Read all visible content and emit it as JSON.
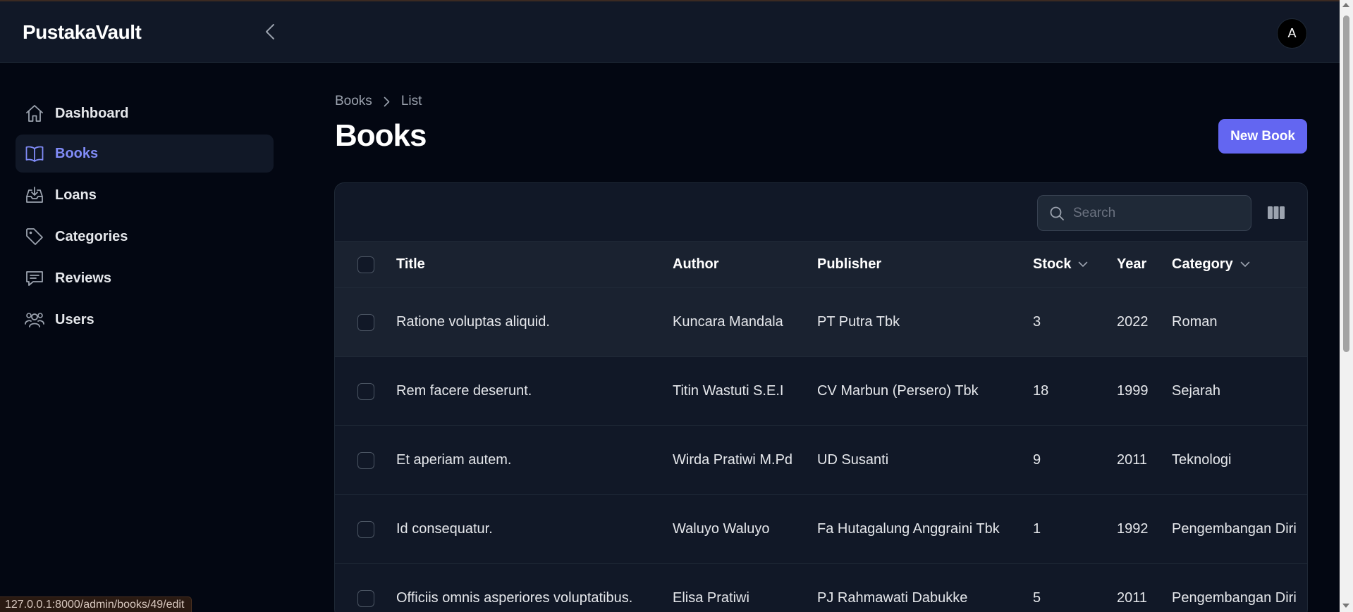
{
  "app": {
    "brand": "PustakaVault",
    "user_initial": "A"
  },
  "sidebar": {
    "items": [
      {
        "label": "Dashboard",
        "icon": "home-icon",
        "active": false
      },
      {
        "label": "Books",
        "icon": "book-open-icon",
        "active": true
      },
      {
        "label": "Loans",
        "icon": "inbox-download-icon",
        "active": false
      },
      {
        "label": "Categories",
        "icon": "tag-icon",
        "active": false
      },
      {
        "label": "Reviews",
        "icon": "chat-bubble-icon",
        "active": false
      },
      {
        "label": "Users",
        "icon": "users-group-icon",
        "active": false
      }
    ]
  },
  "breadcrumb": {
    "items": [
      "Books",
      "List"
    ]
  },
  "page": {
    "title": "Books",
    "new_button": "New Book"
  },
  "table": {
    "search_placeholder": "Search",
    "columns": [
      "Title",
      "Author",
      "Publisher",
      "Stock",
      "Year",
      "Category"
    ],
    "sortable": [
      "Stock",
      "Category"
    ],
    "rows": [
      {
        "title": "Ratione voluptas aliquid.",
        "author": "Kuncara Mandala",
        "publisher": "PT Putra Tbk",
        "stock": "3",
        "year": "2022",
        "category": "Roman"
      },
      {
        "title": "Rem facere deserunt.",
        "author": "Titin Wastuti S.E.I",
        "publisher": "CV Marbun (Persero) Tbk",
        "stock": "18",
        "year": "1999",
        "category": "Sejarah"
      },
      {
        "title": "Et aperiam autem.",
        "author": "Wirda Pratiwi M.Pd",
        "publisher": "UD Susanti",
        "stock": "9",
        "year": "2011",
        "category": "Teknologi"
      },
      {
        "title": "Id consequatur.",
        "author": "Waluyo Waluyo",
        "publisher": "Fa Hutagalung Anggraini Tbk",
        "stock": "1",
        "year": "1992",
        "category": "Pengembangan Diri"
      },
      {
        "title": "Officiis omnis asperiores voluptatibus.",
        "author": "Elisa Pratiwi",
        "publisher": "PJ Rahmawati Dabukke",
        "stock": "5",
        "year": "2011",
        "category": "Pengembangan Diri"
      }
    ]
  },
  "status_bar": {
    "url": "127.0.0.1:8000/admin/books/49/edit"
  },
  "colors": {
    "accent": "#6366f1",
    "active_nav_text": "#818cf8",
    "background": "#030712",
    "surface": "#111827"
  }
}
